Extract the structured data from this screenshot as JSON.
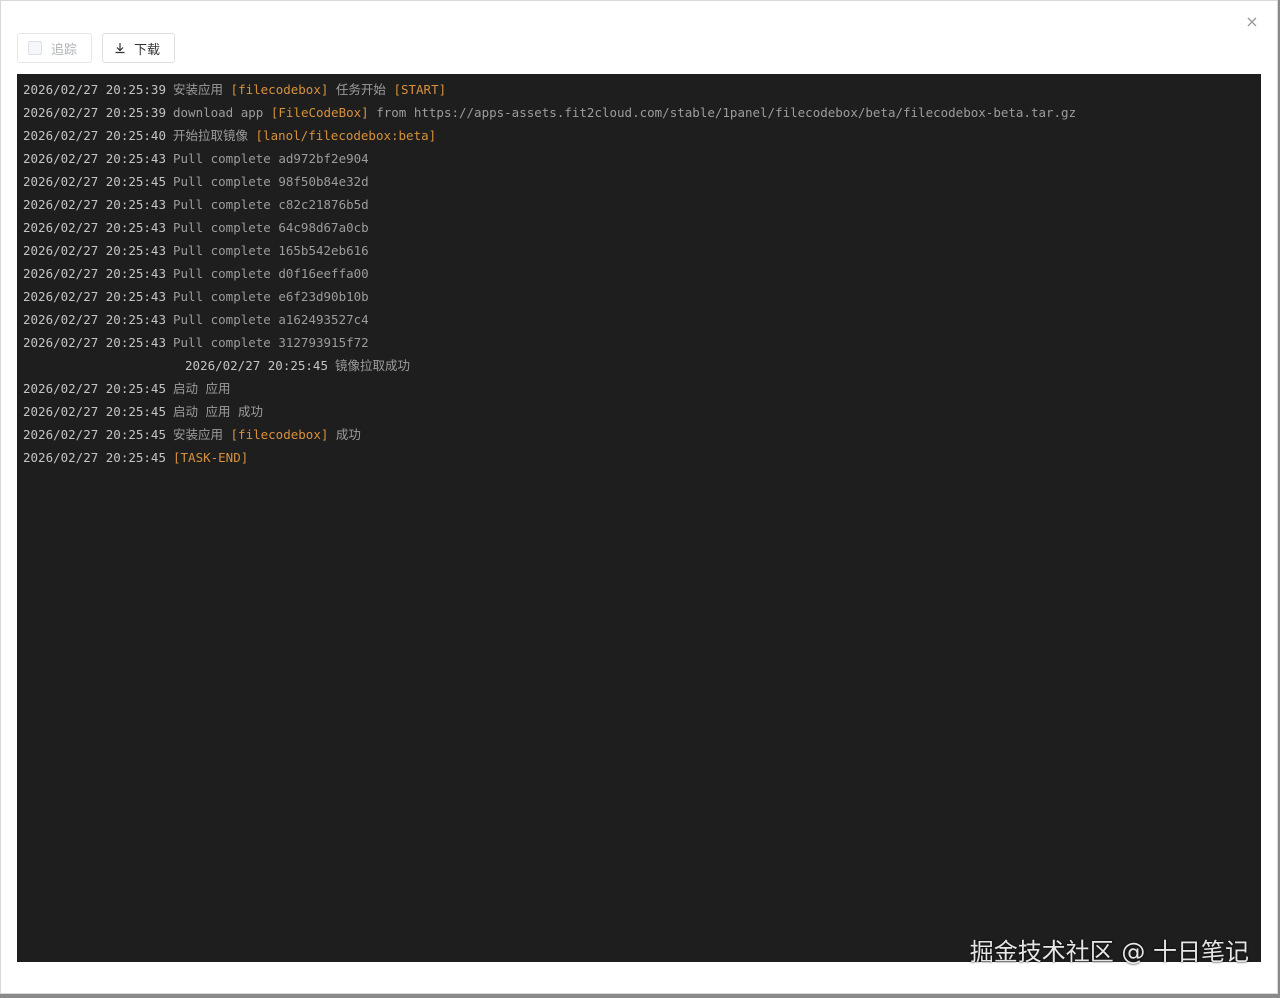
{
  "dialog": {
    "close_icon": "×"
  },
  "toolbar": {
    "follow_label": "追踪",
    "download_label": "下载"
  },
  "log_lines": [
    {
      "ts": "2026/02/27 20:25:39",
      "parts": [
        {
          "t": "安装应用",
          "c": "txt"
        },
        {
          "t": " ",
          "c": "txt"
        },
        {
          "t": "[filecodebox]",
          "c": "hl"
        },
        {
          "t": " 任务开始 ",
          "c": "txt"
        },
        {
          "t": "[START]",
          "c": "hl"
        }
      ]
    },
    {
      "ts": "2026/02/27 20:25:39",
      "parts": [
        {
          "t": "download app ",
          "c": "txt"
        },
        {
          "t": "[FileCodeBox]",
          "c": "hl"
        },
        {
          "t": " from https://apps-assets.fit2cloud.com/stable/1panel/filecodebox/beta/filecodebox-beta.tar.gz",
          "c": "txt"
        }
      ]
    },
    {
      "ts": "2026/02/27 20:25:40",
      "parts": [
        {
          "t": "开始拉取镜像 ",
          "c": "txt"
        },
        {
          "t": "[lanol/filecodebox:beta]",
          "c": "hl"
        }
      ]
    },
    {
      "ts": "2026/02/27 20:25:43",
      "parts": [
        {
          "t": "Pull complete ad972bf2e904",
          "c": "txt"
        }
      ]
    },
    {
      "ts": "2026/02/27 20:25:45",
      "parts": [
        {
          "t": "Pull complete 98f50b84e32d",
          "c": "txt"
        }
      ]
    },
    {
      "ts": "2026/02/27 20:25:43",
      "parts": [
        {
          "t": "Pull complete c82c21876b5d",
          "c": "txt"
        }
      ]
    },
    {
      "ts": "2026/02/27 20:25:43",
      "parts": [
        {
          "t": "Pull complete 64c98d67a0cb",
          "c": "txt"
        }
      ]
    },
    {
      "ts": "2026/02/27 20:25:43",
      "parts": [
        {
          "t": "Pull complete 165b542eb616",
          "c": "txt"
        }
      ]
    },
    {
      "ts": "2026/02/27 20:25:43",
      "parts": [
        {
          "t": "Pull complete d0f16eeffa00",
          "c": "txt"
        }
      ]
    },
    {
      "ts": "2026/02/27 20:25:43",
      "parts": [
        {
          "t": "Pull complete e6f23d90b10b",
          "c": "txt"
        }
      ]
    },
    {
      "ts": "2026/02/27 20:25:43",
      "parts": [
        {
          "t": "Pull complete a162493527c4",
          "c": "txt"
        }
      ]
    },
    {
      "ts": "2026/02/27 20:25:43",
      "parts": [
        {
          "t": "Pull complete 312793915f72",
          "c": "txt"
        }
      ]
    },
    {
      "ts": "2026/02/27 20:25:45",
      "indent": true,
      "parts": [
        {
          "t": "镜像拉取成功",
          "c": "txt"
        }
      ]
    },
    {
      "ts": "2026/02/27 20:25:45",
      "parts": [
        {
          "t": "启动 应用",
          "c": "txt"
        }
      ]
    },
    {
      "ts": "2026/02/27 20:25:45",
      "parts": [
        {
          "t": "启动 应用 成功",
          "c": "txt"
        }
      ]
    },
    {
      "ts": "2026/02/27 20:25:45",
      "parts": [
        {
          "t": "安装应用 ",
          "c": "txt"
        },
        {
          "t": "[filecodebox]",
          "c": "hl"
        },
        {
          "t": " 成功",
          "c": "txt"
        }
      ]
    },
    {
      "ts": "2026/02/27 20:25:45",
      "parts": [
        {
          "t": "[TASK-END]",
          "c": "hl"
        }
      ]
    }
  ],
  "watermark": "掘金技术社区 @ 十日笔记",
  "colors": {
    "terminal_bg": "#1e1e1e",
    "highlight": "#d7913c",
    "timestamp": "#c4c4c4",
    "text": "#9c9c9c"
  }
}
